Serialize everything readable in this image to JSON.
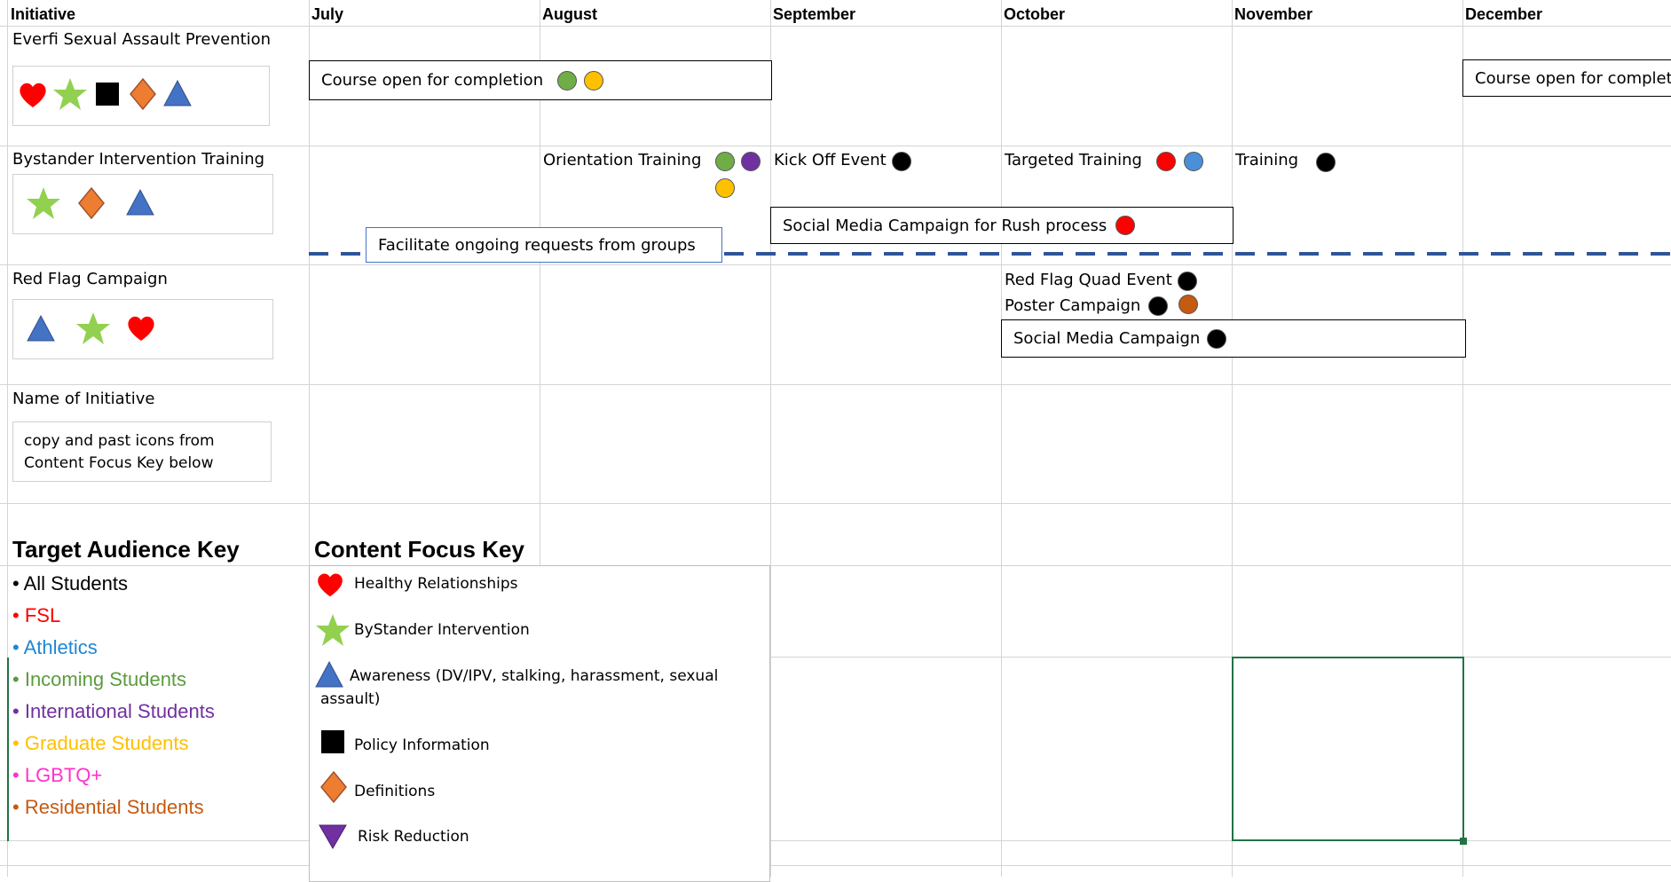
{
  "colors": {
    "all": "#000000",
    "fsl": "#ff0000",
    "athletics": "#1f86d4",
    "incoming": "#5b9b3f",
    "international": "#7030a0",
    "graduate": "#ffc000",
    "lgbtq": "#ff33cc",
    "residential": "#c55a11",
    "shape_heart": "#ff0000",
    "shape_star": "#92d050",
    "shape_triangle": "#4472c4",
    "shape_diamond": "#ed7d31",
    "shape_square": "#000000",
    "shape_downtriangle": "#7030a0",
    "dashed_line": "#2f5597"
  },
  "header": {
    "initiative": "Initiative",
    "months": [
      "July",
      "August",
      "September",
      "October",
      "November",
      "December"
    ]
  },
  "initiatives": [
    {
      "name": "Everfi Sexual Assault Prevention",
      "icons": [
        "heart-icon",
        "star-icon",
        "square-icon",
        "diamond-icon",
        "triangle-icon"
      ],
      "events": {
        "course_open": "Course open for completion",
        "course_open_dec": "Course open for completi"
      }
    },
    {
      "name": "Bystander Intervention Training",
      "icons": [
        "star-icon",
        "diamond-icon",
        "triangle-icon"
      ],
      "events": {
        "orientation": "Orientation Training",
        "kickoff": "Kick Off Event",
        "targeted": "Targeted Training",
        "training": "Training",
        "social_media_rush": "Social Media Campaign for Rush process",
        "facilitate": "Facilitate ongoing requests from groups"
      }
    },
    {
      "name": "Red Flag Campaign",
      "icons": [
        "triangle-icon",
        "star-icon",
        "heart-icon"
      ],
      "events": {
        "quad": "Red Flag Quad Event",
        "poster": "Poster Campaign",
        "social_media": "Social Media Campaign"
      }
    },
    {
      "name": "Name of Initiative",
      "note_line1": "copy and past icons from",
      "note_line2": "Content Focus Key below"
    }
  ],
  "target_audience_key": {
    "title": "Target Audience Key",
    "items": [
      {
        "label": "All Students",
        "color_key": "all"
      },
      {
        "label": "FSL",
        "color_key": "fsl"
      },
      {
        "label": "Athletics",
        "color_key": "athletics"
      },
      {
        "label": "Incoming Students",
        "color_key": "incoming"
      },
      {
        "label": "International Students",
        "color_key": "international"
      },
      {
        "label": "Graduate Students",
        "color_key": "graduate"
      },
      {
        "label": "LGBTQ+",
        "color_key": "lgbtq"
      },
      {
        "label": "Residential Students",
        "color_key": "residential"
      }
    ]
  },
  "content_focus_key": {
    "title": "Content Focus Key",
    "items": [
      {
        "icon": "heart-icon",
        "label": "Healthy Relationships"
      },
      {
        "icon": "star-icon",
        "label": "ByStander Intervention"
      },
      {
        "icon": "triangle-icon",
        "label": "Awareness (DV/IPV, stalking, harassment, sexual",
        "label_cont": "assault)"
      },
      {
        "icon": "square-icon",
        "label": "Policy Information"
      },
      {
        "icon": "diamond-icon",
        "label": "Definitions"
      },
      {
        "icon": "down-triangle-icon",
        "label": "Risk Reduction"
      }
    ]
  }
}
